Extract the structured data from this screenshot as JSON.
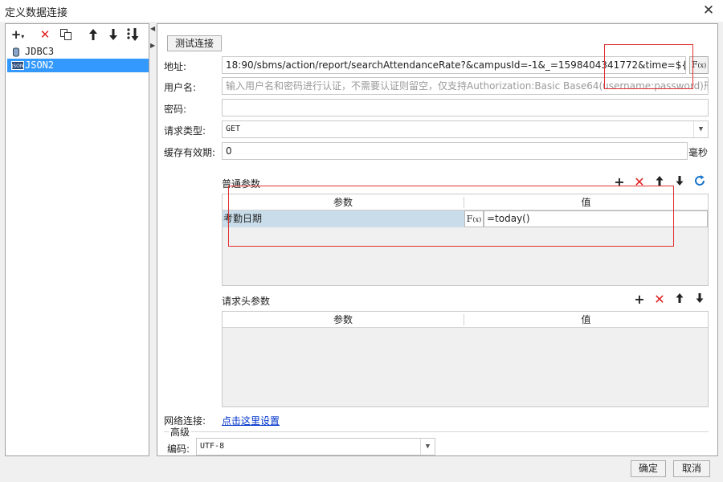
{
  "window": {
    "title": "定义数据连接",
    "close_icon": "close-icon"
  },
  "left_panel": {
    "toolbar": [
      {
        "name": "add",
        "glyph": "+",
        "icon": "plus-dropdown-icon"
      },
      {
        "name": "delete",
        "glyph": "✕",
        "icon": "delete-icon",
        "color": "#e02020"
      },
      {
        "name": "copy",
        "glyph": "⧉",
        "icon": "copy-icon"
      },
      {
        "name": "move-up",
        "glyph": "🡑",
        "icon": "arrow-up-icon"
      },
      {
        "name": "move-down",
        "glyph": "🡓",
        "icon": "arrow-down-icon"
      },
      {
        "name": "sort",
        "glyph": "⇣",
        "icon": "sort-icon"
      }
    ],
    "connections": [
      {
        "label": "JDBC3",
        "icon": "database-icon",
        "selected": false
      },
      {
        "label": "JSON2",
        "icon": "json-icon",
        "selected": true
      }
    ]
  },
  "form": {
    "test_button": "测试连接",
    "address_label": "地址:",
    "address_value": "18:90/sbms/action/report/searchAttendanceRate?&campusId=-1&_=1598404341772&time=${考勤日期}",
    "fx_label": "F(x)",
    "username_label": "用户名:",
    "username_placeholder": "输入用户名和密码进行认证，不需要认证则留空，仅支持Authorization:Basic Base64(username:password)形式",
    "password_label": "密码:",
    "password_value": "",
    "request_type_label": "请求类型:",
    "request_type_value": "GET",
    "cache_label": "缓存有效期:",
    "cache_value": "0",
    "cache_unit": "毫秒"
  },
  "params": {
    "title": "普通参数",
    "col_param": "参数",
    "col_value": "值",
    "rows": [
      {
        "name": "考勤日期",
        "fx": "F(x)",
        "value": "=today()"
      }
    ],
    "tools": [
      "plus-icon",
      "delete-icon",
      "arrow-up-icon",
      "arrow-down-icon",
      "refresh-icon"
    ]
  },
  "headers": {
    "title": "请求头参数",
    "col_param": "参数",
    "col_value": "值",
    "tools": [
      "plus-icon",
      "delete-icon",
      "arrow-up-icon",
      "arrow-down-icon"
    ]
  },
  "network": {
    "label": "网络连接:",
    "link": "点击这里设置"
  },
  "advanced": {
    "title": "高级",
    "encoding_label": "编码:",
    "encoding_value": "UTF-8"
  },
  "footer": {
    "ok": "确定",
    "cancel": "取消"
  },
  "colors": {
    "accent": "#3399ff",
    "selected_row": "#c9dcea",
    "delete_red": "#e02020",
    "highlight_box": "#e03030",
    "link_blue": "#0033cc"
  }
}
